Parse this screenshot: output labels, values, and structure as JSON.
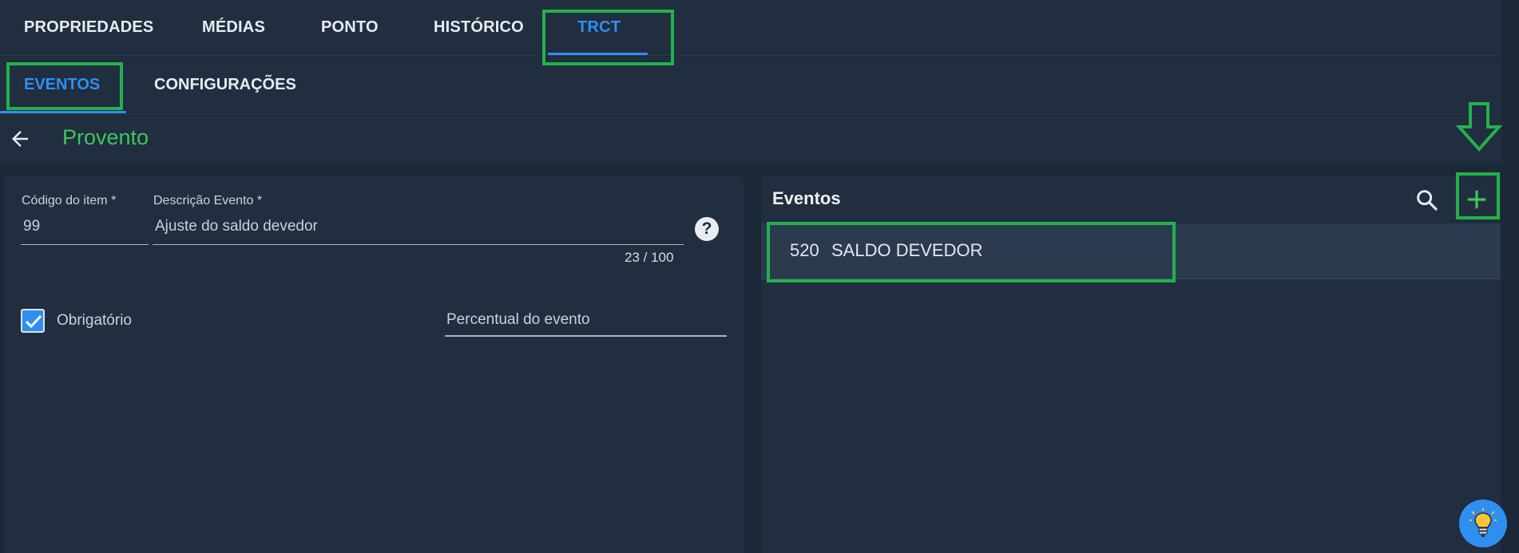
{
  "tabs": [
    {
      "label": "PROPRIEDADES"
    },
    {
      "label": "MÉDIAS"
    },
    {
      "label": "PONTO"
    },
    {
      "label": "HISTÓRICO"
    },
    {
      "label": "TRCT",
      "active": true
    }
  ],
  "subtabs": [
    {
      "label": "EVENTOS",
      "active": true
    },
    {
      "label": "CONFIGURAÇÕES"
    }
  ],
  "header": {
    "title": "Provento"
  },
  "form": {
    "codigo": {
      "label": "Código do item *",
      "value": "99"
    },
    "descricao": {
      "label": "Descrição Evento *",
      "value": "Ajuste do saldo devedor",
      "counter": "23 / 100"
    },
    "obrigatorio": {
      "label": "Obrigatório",
      "checked": true
    },
    "percentual": {
      "placeholder": "Percentual do evento"
    }
  },
  "eventos": {
    "title": "Eventos",
    "items": [
      {
        "code": "520",
        "description": "SALDO DEVEDOR"
      }
    ]
  },
  "icons": {
    "back": "arrow-left-icon",
    "help": "question-circle-icon",
    "search": "search-icon",
    "add": "plus-icon",
    "fab": "lightbulb-icon"
  },
  "colors": {
    "accent": "#2f8ff0",
    "title_green": "#3fc55a",
    "annotation_green": "#22b14c",
    "background": "#1b2838",
    "panel": "#212e3f"
  }
}
